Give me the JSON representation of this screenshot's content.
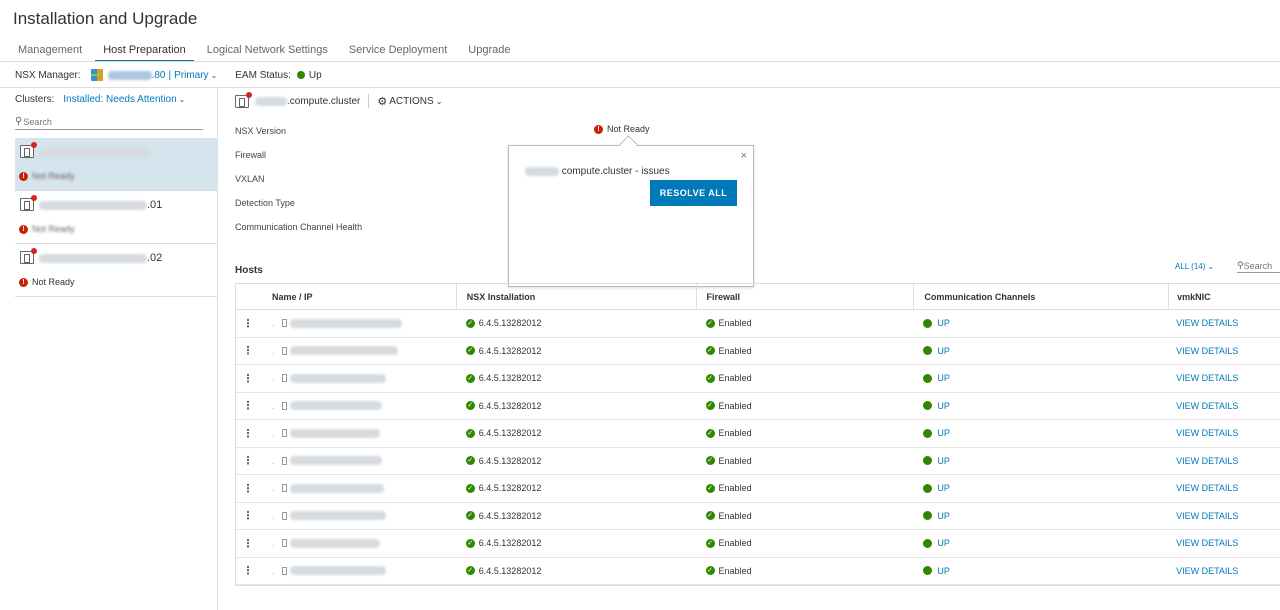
{
  "page": {
    "title": "Installation and Upgrade"
  },
  "tabs": [
    {
      "label": "Management"
    },
    {
      "label": "Host Preparation",
      "active": true
    },
    {
      "label": "Logical Network Settings"
    },
    {
      "label": "Service Deployment"
    },
    {
      "label": "Upgrade"
    }
  ],
  "nsx_bar": {
    "manager_label": "NSX Manager:",
    "manager_ip_suffix": ".80",
    "manager_role": "Primary",
    "eam_label": "EAM Status:",
    "eam_value": "Up"
  },
  "clusters_panel": {
    "label": "Clusters:",
    "filter": "Installed: Needs Attention",
    "search_placeholder": "Search",
    "items": [
      {
        "name_suffix": "",
        "status": "Not Ready",
        "selected": true
      },
      {
        "name_suffix": ".01",
        "status": "Not Ready"
      },
      {
        "name_suffix": ".02",
        "status": "Not Ready"
      }
    ]
  },
  "detail": {
    "cluster_name": ".compute.cluster",
    "actions_label": "ACTIONS",
    "properties": [
      {
        "label": "NSX Version"
      },
      {
        "label": "Firewall"
      },
      {
        "label": "VXLAN"
      },
      {
        "label": "Detection Type"
      },
      {
        "label": "Communication Channel Health"
      }
    ],
    "nsx_version_status": "Not Ready"
  },
  "popover": {
    "title": "compute.cluster - issues",
    "resolve_label": "RESOLVE ALL"
  },
  "hosts": {
    "title": "Hosts",
    "filter_label": "ALL (14)",
    "search_placeholder": "Search",
    "columns": [
      "Name / IP",
      "NSX Installation",
      "Firewall",
      "Communication Channels",
      "vmkNIC"
    ],
    "rows": [
      {
        "nsx": "6.4.5.13282012",
        "firewall": "Enabled",
        "comm": "UP",
        "vmk": "VIEW DETAILS"
      },
      {
        "nsx": "6.4.5.13282012",
        "firewall": "Enabled",
        "comm": "UP",
        "vmk": "VIEW DETAILS"
      },
      {
        "nsx": "6.4.5.13282012",
        "firewall": "Enabled",
        "comm": "UP",
        "vmk": "VIEW DETAILS"
      },
      {
        "nsx": "6.4.5.13282012",
        "firewall": "Enabled",
        "comm": "UP",
        "vmk": "VIEW DETAILS"
      },
      {
        "nsx": "6.4.5.13282012",
        "firewall": "Enabled",
        "comm": "UP",
        "vmk": "VIEW DETAILS"
      },
      {
        "nsx": "6.4.5.13282012",
        "firewall": "Enabled",
        "comm": "UP",
        "vmk": "VIEW DETAILS"
      },
      {
        "nsx": "6.4.5.13282012",
        "firewall": "Enabled",
        "comm": "UP",
        "vmk": "VIEW DETAILS"
      },
      {
        "nsx": "6.4.5.13282012",
        "firewall": "Enabled",
        "comm": "UP",
        "vmk": "VIEW DETAILS"
      },
      {
        "nsx": "6.4.5.13282012",
        "firewall": "Enabled",
        "comm": "UP",
        "vmk": "VIEW DETAILS"
      },
      {
        "nsx": "6.4.5.13282012",
        "firewall": "Enabled",
        "comm": "UP",
        "vmk": "VIEW DETAILS"
      }
    ]
  },
  "colors": {
    "accent": "#0079b8",
    "ok": "#318700",
    "error": "#c92100",
    "selected_bg": "#d6e4ed"
  },
  "icons": {
    "cluster": "cluster-icon",
    "error": "error-icon",
    "success": "check-circle-icon",
    "gear": "gear-icon",
    "search": "search-icon",
    "close": "close-icon",
    "kebab": "kebab-menu-icon",
    "host": "host-icon"
  }
}
